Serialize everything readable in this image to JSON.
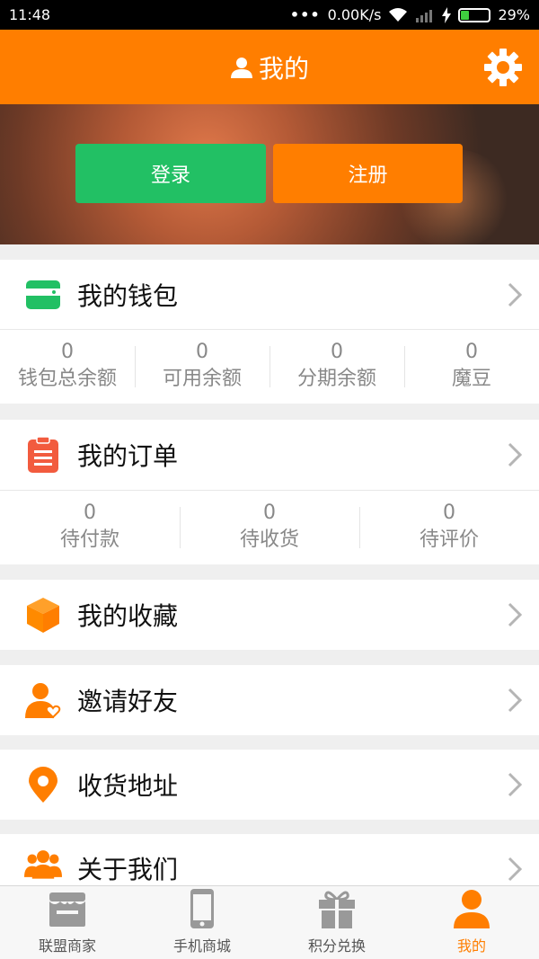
{
  "status_bar": {
    "time": "11:48",
    "network_speed": "0.00K/s",
    "battery": "29%"
  },
  "header": {
    "title": "我的"
  },
  "banner": {
    "login_label": "登录",
    "register_label": "注册"
  },
  "wallet": {
    "title": "我的钱包",
    "stats": [
      {
        "value": "0",
        "label": "钱包总余额"
      },
      {
        "value": "0",
        "label": "可用余额"
      },
      {
        "value": "0",
        "label": "分期余额"
      },
      {
        "value": "0",
        "label": "魔豆"
      }
    ]
  },
  "orders": {
    "title": "我的订单",
    "stats": [
      {
        "value": "0",
        "label": "待付款"
      },
      {
        "value": "0",
        "label": "待收货"
      },
      {
        "value": "0",
        "label": "待评价"
      }
    ]
  },
  "menu": [
    {
      "label": "我的收藏",
      "icon": "box-icon"
    },
    {
      "label": "邀请好友",
      "icon": "invite-friend-icon"
    },
    {
      "label": "收货地址",
      "icon": "location-pin-icon"
    },
    {
      "label": "关于我们",
      "icon": "group-icon"
    }
  ],
  "tabs": [
    {
      "label": "联盟商家",
      "icon": "store-icon"
    },
    {
      "label": "手机商城",
      "icon": "phone-icon"
    },
    {
      "label": "积分兑换",
      "icon": "gift-icon"
    },
    {
      "label": "我的",
      "icon": "user-icon",
      "active": true
    }
  ],
  "colors": {
    "accent": "#ff7e00",
    "login": "#22c064",
    "wallet": "#22c064",
    "orders": "#f25b3e"
  }
}
